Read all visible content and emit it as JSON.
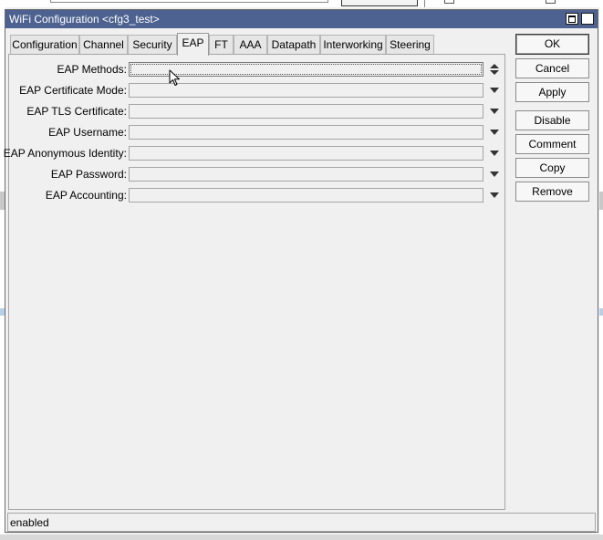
{
  "window": {
    "title": "WiFi Configuration <cfg3_test>",
    "maximize_icon": "maximize-icon",
    "close_icon": "close-icon",
    "close_glyph": "×"
  },
  "tabs": [
    {
      "label": "Configuration",
      "active": false
    },
    {
      "label": "Channel",
      "active": false
    },
    {
      "label": "Security",
      "active": false
    },
    {
      "label": "EAP",
      "active": true
    },
    {
      "label": "FT",
      "active": false
    },
    {
      "label": "AAA",
      "active": false
    },
    {
      "label": "Datapath",
      "active": false
    },
    {
      "label": "Interworking",
      "active": false
    },
    {
      "label": "Steering",
      "active": false
    }
  ],
  "fields": [
    {
      "label": "EAP Methods:",
      "value": "",
      "control": "updown"
    },
    {
      "label": "EAP Certificate Mode:",
      "value": "",
      "control": "dropdown"
    },
    {
      "label": "EAP TLS Certificate:",
      "value": "",
      "control": "dropdown"
    },
    {
      "label": "EAP Username:",
      "value": "",
      "control": "dropdown"
    },
    {
      "label": "EAP Anonymous Identity:",
      "value": "",
      "control": "dropdown"
    },
    {
      "label": "EAP Password:",
      "value": "",
      "control": "dropdown"
    },
    {
      "label": "EAP Accounting:",
      "value": "",
      "control": "dropdown"
    }
  ],
  "buttons": {
    "ok": "OK",
    "cancel": "Cancel",
    "apply": "Apply",
    "disable": "Disable",
    "comment": "Comment",
    "copy": "Copy",
    "remove": "Remove"
  },
  "status": {
    "text": "enabled"
  },
  "colors": {
    "titlebar": "#4d6290",
    "window_bg": "#f0f0f0"
  }
}
